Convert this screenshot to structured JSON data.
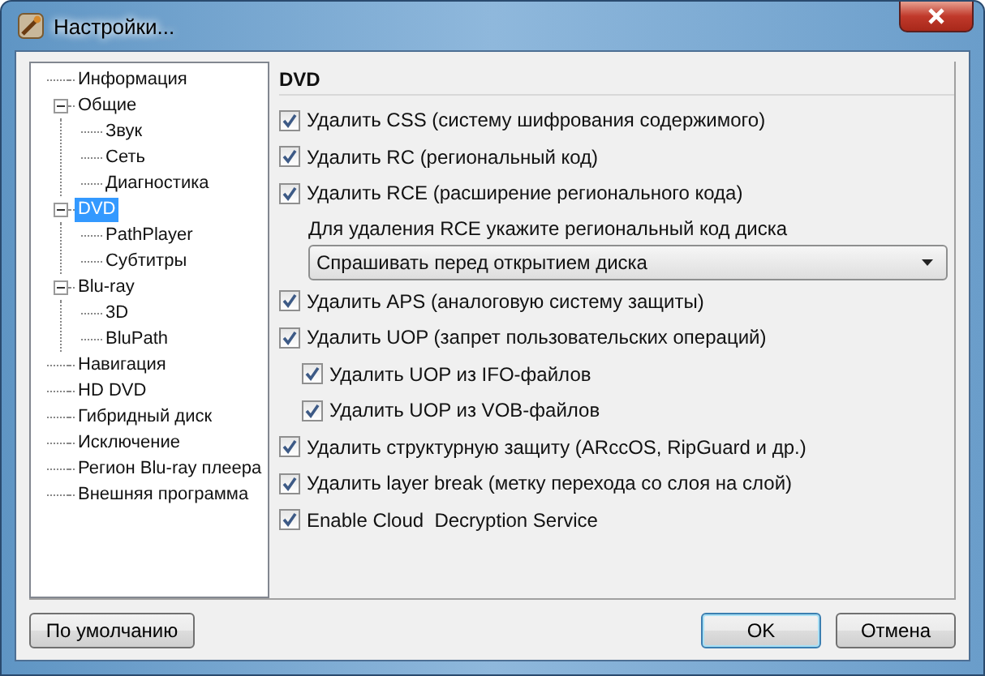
{
  "window": {
    "title": "Настройки..."
  },
  "tree": [
    {
      "label": "Информация",
      "selected": false
    },
    {
      "label": "Общие",
      "selected": false,
      "expanded": true,
      "children": [
        {
          "label": "Звук",
          "selected": false
        },
        {
          "label": "Сеть",
          "selected": false
        },
        {
          "label": "Диагностика",
          "selected": false
        }
      ]
    },
    {
      "label": "DVD",
      "selected": true,
      "expanded": true,
      "children": [
        {
          "label": "PathPlayer",
          "selected": false
        },
        {
          "label": "Субтитры",
          "selected": false
        }
      ]
    },
    {
      "label": "Blu-ray",
      "selected": false,
      "expanded": true,
      "children": [
        {
          "label": "3D",
          "selected": false
        },
        {
          "label": "BluPath",
          "selected": false
        }
      ]
    },
    {
      "label": "Навигация",
      "selected": false
    },
    {
      "label": "HD DVD",
      "selected": false
    },
    {
      "label": "Гибридный диск",
      "selected": false
    },
    {
      "label": "Исключение",
      "selected": false
    },
    {
      "label": "Регион Blu-ray плеера",
      "selected": false
    },
    {
      "label": "Внешняя программа",
      "selected": false
    }
  ],
  "panel": {
    "heading": "DVD",
    "options": [
      {
        "kind": "checkbox",
        "label": "Удалить CSS (систему шифрования содержимого)",
        "checked": true
      },
      {
        "kind": "checkbox",
        "label": "Удалить RC (региональный код)",
        "checked": true
      },
      {
        "kind": "checkbox",
        "label": "Удалить RCE (расширение регионального кода)",
        "checked": true
      },
      {
        "kind": "note",
        "label": "Для удаления RCE укажите региональный код диска"
      },
      {
        "kind": "select",
        "value": "Спрашивать перед открытием диска"
      },
      {
        "kind": "checkbox",
        "label": "Удалить APS (аналоговую систему защиты)",
        "checked": true
      },
      {
        "kind": "checkbox",
        "label": "Удалить UOP (запрет пользовательских операций)",
        "checked": true,
        "children": [
          {
            "label": "Удалить UOP из IFO-файлов",
            "checked": true
          },
          {
            "label": "Удалить UOP из VOB-файлов",
            "checked": true
          }
        ]
      },
      {
        "kind": "checkbox",
        "label": "Удалить структурную защиту (ARccOS, RipGuard и др.)",
        "checked": true
      },
      {
        "kind": "checkbox",
        "label": "Удалить layer break (метку перехода со слоя на слой)",
        "checked": true
      },
      {
        "kind": "checkbox",
        "label": "Enable Cloud  Decryption Service",
        "checked": true
      }
    ]
  },
  "buttons": {
    "defaults": "По умолчанию",
    "ok": "OK",
    "cancel": "Отмена"
  }
}
